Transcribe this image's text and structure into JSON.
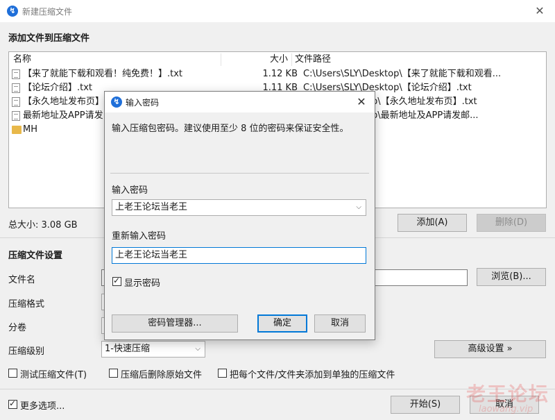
{
  "window": {
    "title": "新建压缩文件",
    "close": "✕"
  },
  "add_section": {
    "title": "添加文件到压缩文件"
  },
  "filelist": {
    "columns": {
      "name": "名称",
      "size": "大小",
      "path": "文件路径"
    },
    "rows": [
      {
        "name": "【来了就能下载和观看！纯免费！】.txt",
        "size": "1.12 KB",
        "path": "C:\\Users\\SLY\\Desktop\\【来了就能下载和观看..."
      },
      {
        "name": "【论坛介绍】.txt",
        "size": "1.11 KB",
        "path": "C:\\Users\\SLY\\Desktop\\【论坛介绍】.txt"
      },
      {
        "name": "【永久地址发布页】",
        "size": "",
        "path": "op\\【永久地址发布页】.txt"
      },
      {
        "name": "最新地址及APP请发",
        "size": "",
        "path": "op\\最新地址及APP请发邮..."
      },
      {
        "name": "MH",
        "size": "",
        "path": ""
      }
    ]
  },
  "total": {
    "label": "总大小: 3.08 GB"
  },
  "buttons": {
    "add": "添加(A)",
    "delete": "删除(D)",
    "browse": "浏览(B)...",
    "advanced": "高级设置 »",
    "start": "开始(S)",
    "cancel": "取消"
  },
  "settings": {
    "title": "压缩文件设置",
    "filename_label": "文件名",
    "format_label": "压缩格式",
    "split_label": "分卷",
    "level_label": "压缩级别",
    "level_value": "1-快速压缩"
  },
  "options": {
    "test": "测试压缩文件(T)",
    "delete_after": "压缩后删除原始文件",
    "separate": "把每个文件/文件夹添加到单独的压缩文件",
    "more": "更多选项..."
  },
  "watermark": {
    "main": "老王论坛",
    "sub": "laowang.vip"
  },
  "dialog": {
    "title": "输入密码",
    "description": "输入压缩包密码。建议使用至少 8 位的密码来保证安全性。",
    "password_label": "输入密码",
    "password_value": "上老王论坛当老王",
    "confirm_label": "重新输入密码",
    "confirm_value": "上老王论坛当老王",
    "show_password": "显示密码",
    "manager": "密码管理器...",
    "ok": "确定",
    "cancel": "取消",
    "close": "✕"
  }
}
